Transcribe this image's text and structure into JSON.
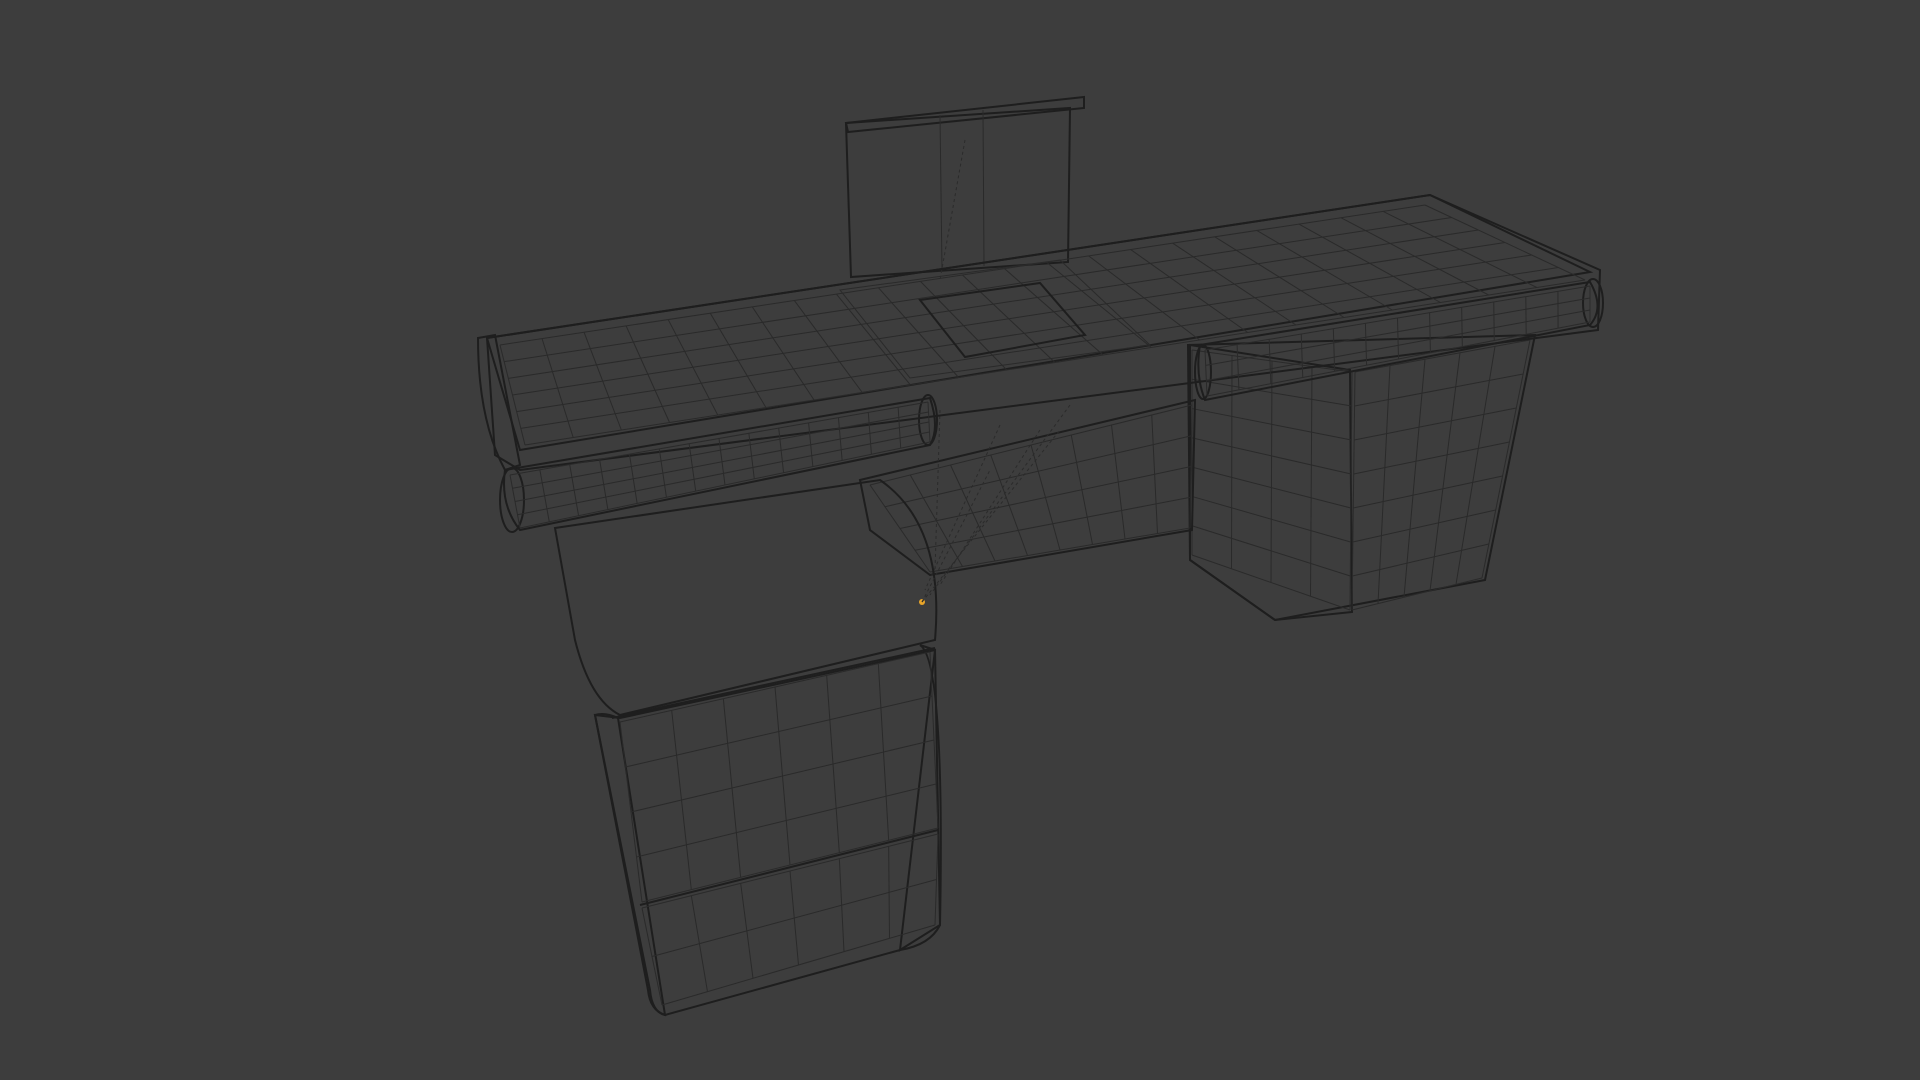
{
  "viewport": {
    "background": "#3d3d3d",
    "mode": "3d-viewport"
  },
  "mesh": {
    "object": "checkout-counter",
    "display": "wireframe-overlay-solid",
    "face_color": "#9b9b9b",
    "side_color": "#858585",
    "dark_color": "#5e5e5e",
    "wire_color": "#2a2a2a",
    "selected_vertex_color": "#e8a52a"
  }
}
